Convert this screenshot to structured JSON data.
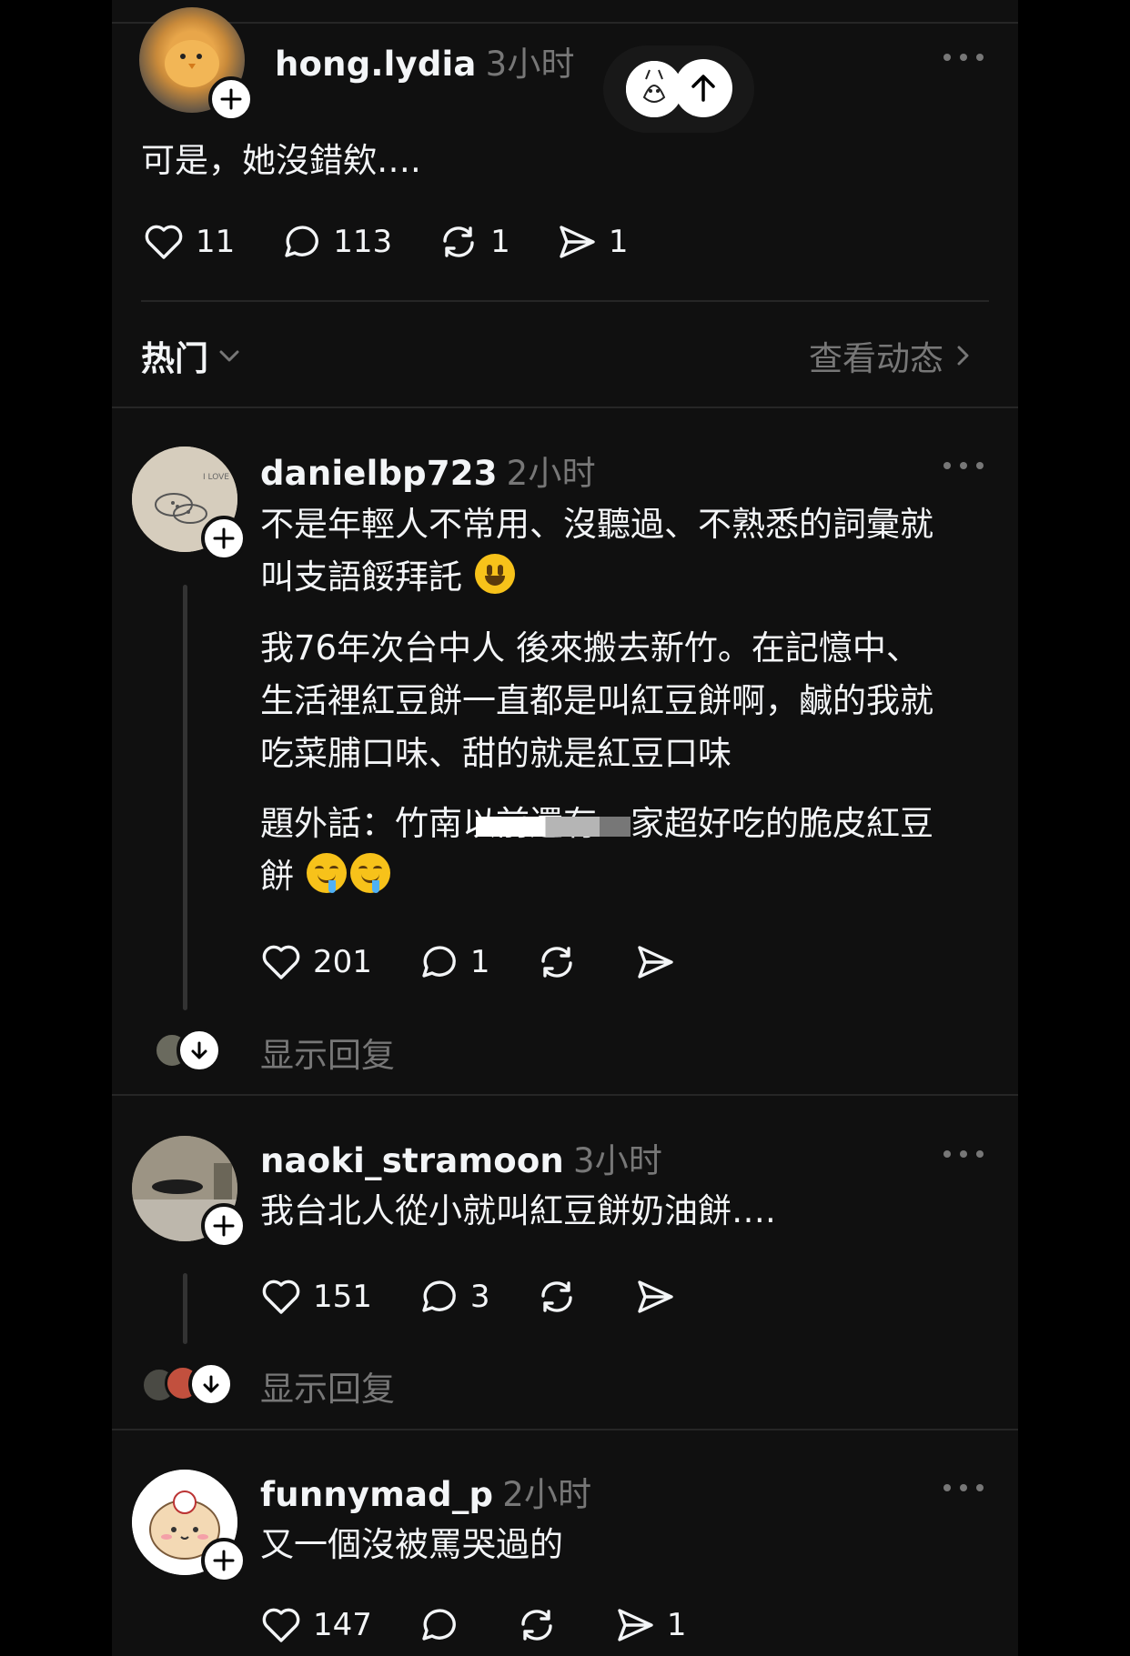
{
  "top_post": {
    "username": "hong.lydia",
    "time": "3小时",
    "text": "可是，她沒錯欸….",
    "likes": "11",
    "comments": "113",
    "reposts": "1",
    "shares": "1"
  },
  "sort_bar": {
    "sort_label": "热门",
    "activity_link": "查看动态"
  },
  "replies": [
    {
      "username": "danielbp723",
      "time": "2小时",
      "paragraph1": "不是年輕人不常用、沒聽過、不熟悉的詞彙就",
      "paragraph1_line2": "叫支語餒拜託",
      "paragraph2_lines": [
        "我76年次台中人 後來搬去新竹。在記憶中、",
        "生活裡紅豆餅一直都是叫紅豆餅啊，鹹的我就",
        "吃菜脯口味、甜的就是紅豆口味"
      ],
      "paragraph3_start": "題外話：竹南以前還有一",
      "paragraph3_end": "家超好吃的脆皮紅豆",
      "paragraph3_line2": "餅",
      "likes": "201",
      "comments": "1",
      "show_replies": "显示回复"
    },
    {
      "username": "naoki_stramoon",
      "time": "3小时",
      "text": "我台北人從小就叫紅豆餅奶油餅….",
      "likes": "151",
      "comments": "3",
      "show_replies": "显示回复"
    },
    {
      "username": "funnymad_p",
      "time": "2小时",
      "text": "又一個沒被罵哭過的",
      "likes": "147",
      "shares": "1"
    }
  ],
  "colors": {
    "background": "#101010",
    "text_primary": "#f3f5f7",
    "text_secondary": "#777777",
    "separator": "#262626"
  }
}
